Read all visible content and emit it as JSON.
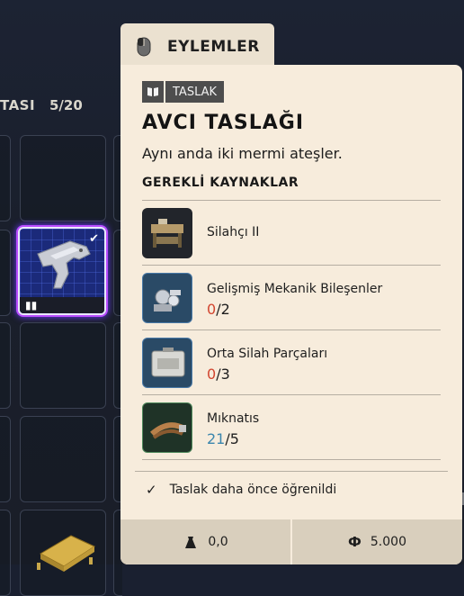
{
  "stash": {
    "title": "TASI",
    "count": "5/20"
  },
  "actions_tab": {
    "label": "EYLEMLER",
    "icon": "mouse-icon"
  },
  "item": {
    "tag": "TASLAK",
    "tag_icon": "book-icon",
    "title": "AVCI TASLAĞI",
    "description": "Aynı anda iki mermi ateşler."
  },
  "requirements": {
    "header": "GEREKLİ KAYNAKLAR",
    "items": [
      {
        "name": "Silahçı II",
        "have": "",
        "need": ""
      },
      {
        "name": "Gelişmiş Mekanik Bileşenler",
        "have": "0",
        "need": "/2"
      },
      {
        "name": "Orta Silah Parçaları",
        "have": "0",
        "need": "/3"
      },
      {
        "name": "Mıknatıs",
        "have": "21",
        "need": "/5"
      }
    ]
  },
  "learned": {
    "text": "Taslak daha önce öğrenildi"
  },
  "footer": {
    "weight": "0,0",
    "value": "5.000"
  },
  "colors": {
    "panel_bg": "#f7ecdc",
    "missing": "#d2452f",
    "owned": "#3b86ad",
    "selected_glow": "#b84cff"
  }
}
